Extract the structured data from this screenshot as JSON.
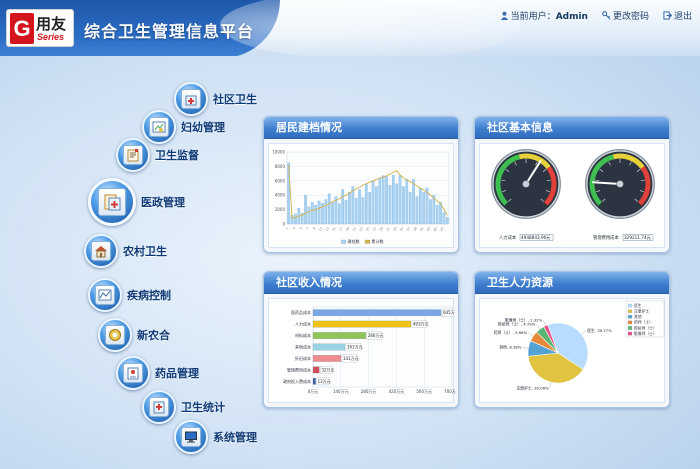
{
  "header": {
    "logo_glyph": "G",
    "logo_cn": "用友",
    "logo_en": "Series",
    "title": "综合卫生管理信息平台",
    "user_label": "当前用户：",
    "user_name": "Admin",
    "change_password": "更改密码",
    "exit": "退出"
  },
  "nav": {
    "items": [
      {
        "label": "社区卫生",
        "icon": "clinic-icon"
      },
      {
        "label": "妇幼管理",
        "icon": "maternal-icon"
      },
      {
        "label": "卫生监督",
        "icon": "inspection-icon"
      },
      {
        "label": "医政管理",
        "icon": "medical-admin-icon",
        "active": true
      },
      {
        "label": "农村卫生",
        "icon": "rural-house-icon"
      },
      {
        "label": "疾病控制",
        "icon": "disease-control-icon"
      },
      {
        "label": "新农合",
        "icon": "cooperative-icon"
      },
      {
        "label": "药品管理",
        "icon": "drug-icon"
      },
      {
        "label": "卫生统计",
        "icon": "statistics-icon"
      },
      {
        "label": "系统管理",
        "icon": "computer-icon"
      }
    ]
  },
  "panels": {
    "archive": {
      "title": "居民建档情况"
    },
    "community": {
      "title": "社区基本信息"
    },
    "income": {
      "title": "社区收入情况"
    },
    "hr": {
      "title": "卫生人力资源"
    }
  },
  "chart_data": [
    {
      "type": "bar",
      "title": "",
      "y_ticks": [
        "10000",
        "8000",
        "6000",
        "4000",
        "2000",
        "0"
      ],
      "ylim": [
        0,
        10000
      ],
      "categories": [
        "1",
        "2",
        "3",
        "4",
        "5",
        "6",
        "7",
        "8",
        "9",
        "10",
        "11",
        "12",
        "13",
        "14",
        "15",
        "16",
        "17",
        "18",
        "19",
        "20",
        "21",
        "22",
        "23",
        "24",
        "25",
        "26",
        "27",
        "28",
        "29",
        "30",
        "31",
        "32",
        "33",
        "34",
        "35",
        "36",
        "37",
        "38",
        "39",
        "40",
        "41",
        "42",
        "43",
        "44",
        "45",
        "46",
        "47",
        "48"
      ],
      "series": [
        {
          "name": "建档数",
          "type": "bar",
          "color": "#a9d2f2",
          "values": [
            8500,
            1200,
            1400,
            2200,
            1500,
            4000,
            2400,
            3000,
            2600,
            3200,
            2900,
            3400,
            4200,
            3000,
            3800,
            2800,
            4800,
            3300,
            4400,
            5200,
            3600,
            4800,
            3700,
            5600,
            4400,
            6000,
            5200,
            6400,
            6700,
            6600,
            5400,
            6800,
            5600,
            6800,
            5200,
            6200,
            4400,
            6200,
            3800,
            5000,
            4400,
            5000,
            3400,
            4000,
            2600,
            3000,
            1600,
            900
          ]
        },
        {
          "name": "累计数",
          "type": "line",
          "color": "#d2b24a",
          "values": [
            8200,
            800,
            900,
            1100,
            1200,
            1500,
            1700,
            1900,
            2000,
            2200,
            2400,
            2600,
            2800,
            3100,
            3300,
            3500,
            3800,
            4000,
            4300,
            4600,
            4900,
            5100,
            5400,
            5600,
            5800,
            6000,
            6200,
            6400,
            6500,
            6700,
            6900,
            7200,
            7400,
            6800,
            6400,
            6100,
            5900,
            5600,
            5300,
            5000,
            4700,
            4400,
            4000,
            3600,
            3200,
            2800,
            2000,
            1200
          ]
        }
      ],
      "legend": [
        "建档数",
        "累计数"
      ]
    },
    {
      "type": "gauge",
      "gauges": [
        {
          "label": "人力成本",
          "value_text": "4948843.90元",
          "value": 0.62,
          "min": 0,
          "max": 1
        },
        {
          "label": "管理费用成本",
          "value_text": "329211.74元",
          "value": 0.18,
          "min": 0,
          "max": 1
        }
      ]
    },
    {
      "type": "bar",
      "orientation": "horizontal",
      "title": "",
      "categories": [
        "医药品成本",
        "人力成本",
        "材料成本",
        "其他成本",
        "折旧成本",
        "管理费用成本",
        "政府投入费成本"
      ],
      "values": [
        645,
        493,
        266,
        161,
        141,
        32,
        13
      ],
      "value_labels": [
        "645万元",
        "493万元",
        "266万元",
        "161万元",
        "141万元",
        "32万元",
        "13万元"
      ],
      "colors": [
        "#7aa8e6",
        "#f0c417",
        "#8fc457",
        "#9ad3e6",
        "#ef8e8e",
        "#d0505a",
        "#3b5ea8"
      ],
      "x_ticks": [
        "0万元",
        "140万元",
        "280万元",
        "420万元",
        "560万元",
        "700万元"
      ],
      "xlim": [
        0,
        700
      ]
    },
    {
      "type": "pie",
      "slices": [
        {
          "name": "医生",
          "value": 39.77,
          "label": "医生, 39.77%",
          "color": "#b8dcff"
        },
        {
          "name": "注册护士",
          "value": 39.06,
          "label": "注册护士, 39.06%",
          "color": "#e0c341"
        },
        {
          "name": "其他",
          "value": 8.38,
          "label": "其他, 8.38%",
          "color": "#54a2d4"
        },
        {
          "name": "药师（士）",
          "value": 5.66,
          "label": "药师（士）, 5.66%",
          "color": "#e58a3a"
        },
        {
          "name": "检验师（士）",
          "value": 4.79,
          "label": "检验师（士）, 4.79%",
          "color": "#5ab572"
        },
        {
          "name": "影像师（士）",
          "value": 2.32,
          "label": "影像师（士）, 2.32%",
          "color": "#e7518a"
        }
      ],
      "legend": [
        "医生",
        "注册护士",
        "其他",
        "药师（士）",
        "检验师（士）",
        "影像师（士）"
      ]
    }
  ]
}
